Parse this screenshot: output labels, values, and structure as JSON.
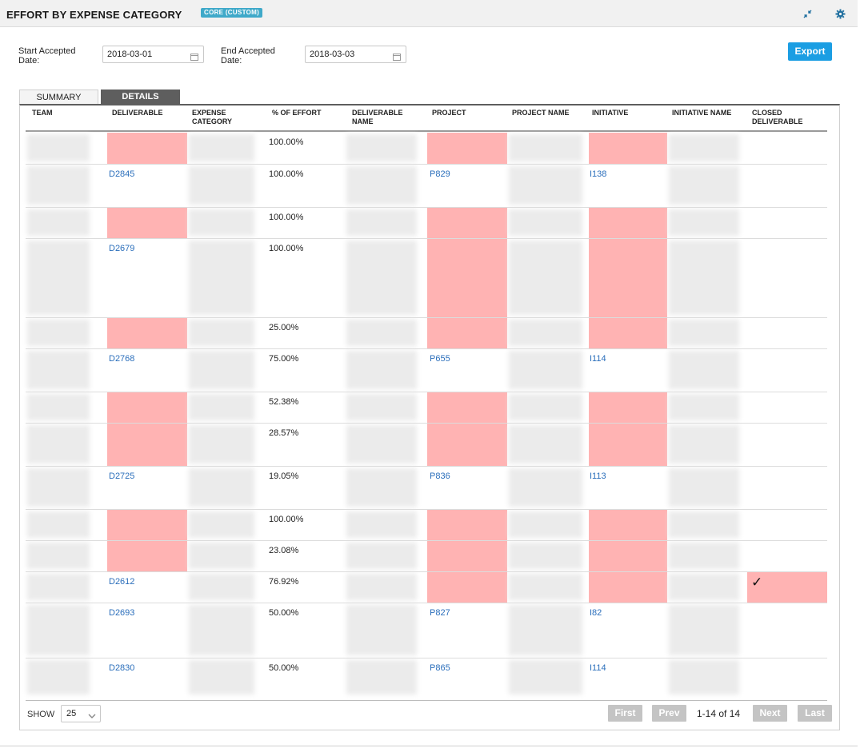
{
  "header": {
    "title": "EFFORT BY EXPENSE CATEGORY",
    "badge": "CORE (CUSTOM)",
    "icons": [
      "collapse-icon",
      "gear-icon"
    ],
    "accent": "#3fa9c9"
  },
  "filters": {
    "start_label": "Start Accepted Date:",
    "start_value": "2018-03-01",
    "end_label": "End Accepted Date:",
    "end_value": "2018-03-03",
    "export_label": "Export",
    "export_color": "#1b9ee3"
  },
  "tabs": [
    {
      "label": "SUMMARY",
      "active": false
    },
    {
      "label": "DETAILS",
      "active": true
    }
  ],
  "table": {
    "columns": [
      "TEAM",
      "DELIVERABLE",
      "EXPENSE CATEGORY",
      "% OF EFFORT",
      "DELIVERABLE NAME",
      "PROJECT",
      "PROJECT NAME",
      "INITIATIVE",
      "INITIATIVE NAME",
      "CLOSED DELIVERABLE"
    ],
    "highlight_color": "#ffb3b3",
    "rows": [
      {
        "deliverable": "",
        "effort": "100.00%",
        "project": "",
        "initiative": "",
        "closed": ""
      },
      {
        "deliverable": "D2845",
        "effort": "100.00%",
        "project": "P829",
        "initiative": "I138",
        "closed": ""
      },
      {
        "deliverable": "",
        "effort": "100.00%",
        "project": "",
        "initiative": "",
        "closed": ""
      },
      {
        "deliverable": "D2679",
        "effort": "100.00%",
        "project": "",
        "initiative": "",
        "closed": ""
      },
      {
        "deliverable": "",
        "effort": "25.00%",
        "project": "",
        "initiative": "",
        "closed": ""
      },
      {
        "deliverable": "D2768",
        "effort": "75.00%",
        "project": "P655",
        "initiative": "I114",
        "closed": ""
      },
      {
        "deliverable": "",
        "effort": "52.38%",
        "project": "",
        "initiative": "",
        "closed": ""
      },
      {
        "deliverable": "",
        "effort": "28.57%",
        "project": "",
        "initiative": "",
        "closed": ""
      },
      {
        "deliverable": "D2725",
        "effort": "19.05%",
        "project": "P836",
        "initiative": "I113",
        "closed": ""
      },
      {
        "deliverable": "",
        "effort": "100.00%",
        "project": "",
        "initiative": "",
        "closed": ""
      },
      {
        "deliverable": "",
        "effort": "23.08%",
        "project": "",
        "initiative": "",
        "closed": ""
      },
      {
        "deliverable": "D2612",
        "effort": "76.92%",
        "project": "",
        "initiative": "",
        "closed": "✓"
      },
      {
        "deliverable": "D2693",
        "effort": "50.00%",
        "project": "P827",
        "initiative": "I82",
        "closed": ""
      },
      {
        "deliverable": "D2830",
        "effort": "50.00%",
        "project": "P865",
        "initiative": "I114",
        "closed": ""
      }
    ]
  },
  "footer": {
    "show_label": "SHOW",
    "page_size": "25",
    "first": "First",
    "prev": "Prev",
    "page_info": "1-14 of 14",
    "next": "Next",
    "last": "Last"
  }
}
